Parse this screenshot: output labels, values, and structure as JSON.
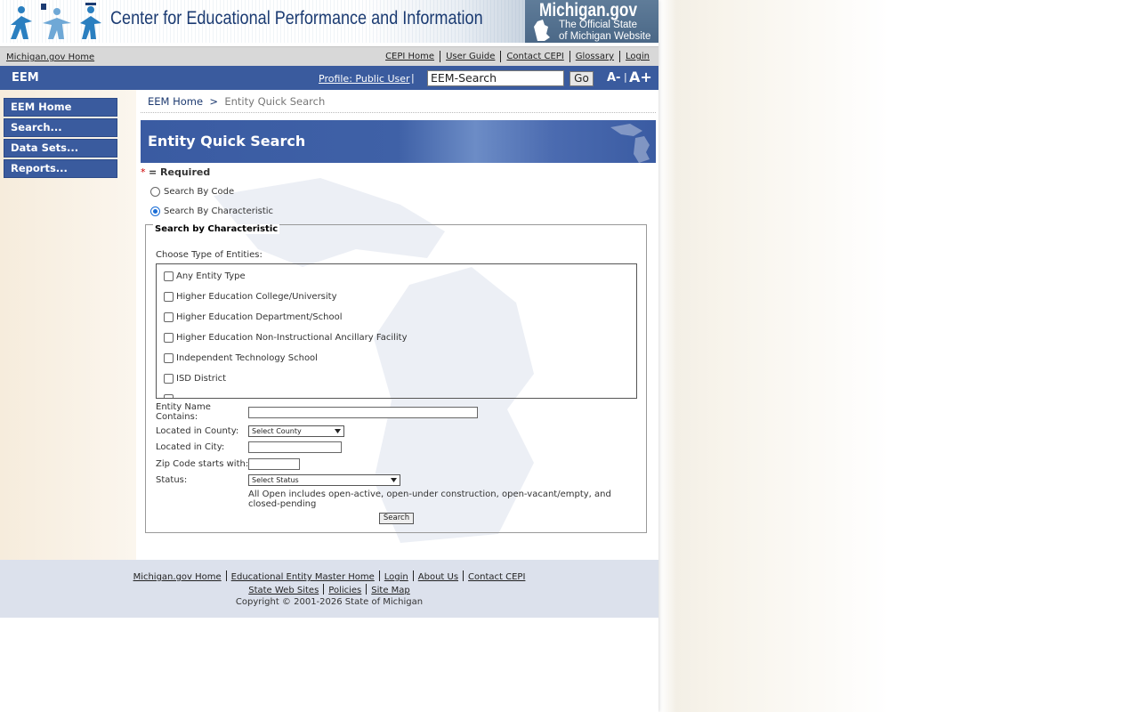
{
  "banner": {
    "title": "Center for Educational Performance and Information",
    "michigan_title": "Michigan.gov",
    "michigan_sub1": "The Official State",
    "michigan_sub2": "of Michigan Website"
  },
  "utility": {
    "left_link": "Michigan.gov Home",
    "links": [
      "CEPI Home",
      "User Guide",
      "Contact CEPI",
      "Glossary",
      "Login"
    ]
  },
  "eembar": {
    "app": "EEM",
    "profile": "Profile: Public User",
    "pipe": "|",
    "search_value": "EEM-Search",
    "go": "Go",
    "a_minus": "A-",
    "divider": "|",
    "a_plus": "A+"
  },
  "nav": {
    "items": [
      "EEM Home",
      "Search...",
      "Data Sets...",
      "Reports..."
    ]
  },
  "breadcrumb": {
    "home": "EEM Home",
    "sep": ">",
    "current": "Entity Quick Search"
  },
  "page_title": "Entity Quick Search",
  "required": {
    "star": "*",
    "text": "= Required"
  },
  "radios": {
    "by_code": "Search By Code",
    "by_characteristic": "Search By Characteristic",
    "selected": "by_characteristic"
  },
  "fieldset": {
    "legend": "Search by Characteristic",
    "choose_label": "Choose Type of Entities:",
    "entity_types": [
      "Any Entity Type",
      "Higher Education College/University",
      "Higher Education Department/School",
      "Higher Education Non-Instructional Ancillary Facility",
      "Independent Technology School",
      "ISD District"
    ],
    "name_label": "Entity Name Contains:",
    "county_label": "Located in County:",
    "county_select": "Select County",
    "city_label": "Located in City:",
    "zip_label": "Zip Code starts with:",
    "status_label": "Status:",
    "status_select": "Select Status",
    "note": "All Open includes open-active, open-under construction, open-vacant/empty, and closed-pending",
    "search_button": "Search"
  },
  "footer": {
    "row1": [
      "Michigan.gov Home",
      "Educational Entity Master Home",
      "Login",
      "About Us",
      "Contact CEPI"
    ],
    "row2": [
      "State Web Sites",
      "Policies",
      "Site Map"
    ],
    "copyright": "Copyright © 2001-2026 State of Michigan"
  },
  "colors": {
    "nav_blue": "#3a5b9e",
    "footer_bg": "#dce1ec",
    "util_bg": "#d8d8d8"
  }
}
